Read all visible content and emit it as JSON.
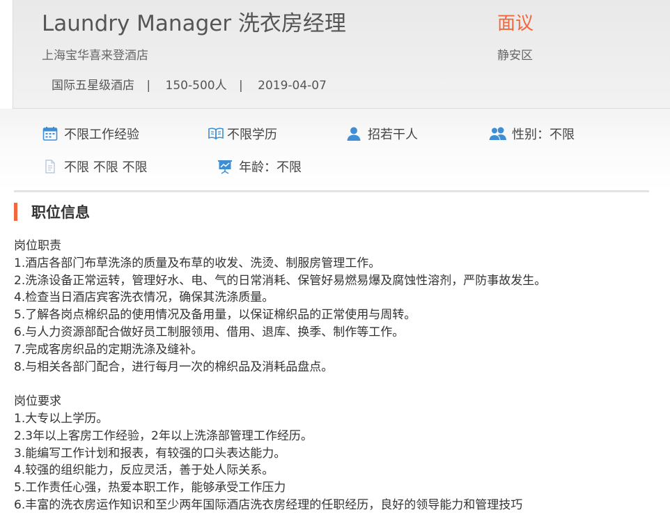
{
  "job": {
    "title": "Laundry Manager 洗衣房经理",
    "salary": "面议",
    "company": "上海宝华喜来登酒店",
    "district": "静安区",
    "meta": {
      "industry": "国际五星级酒店",
      "size": "150-500人",
      "date": "2019-04-07",
      "separator": "|"
    }
  },
  "requirements": {
    "experience": {
      "icon": "calendar-icon",
      "label": "不限工作经验"
    },
    "education": {
      "icon": "book-icon",
      "label": "不限学历"
    },
    "headcount": {
      "icon": "person-icon",
      "label": "招若干人"
    },
    "gender": {
      "icon": "people-icon",
      "label": "性别：不限"
    },
    "other": {
      "icon": "document-icon",
      "label": "不限 不限 不限"
    },
    "age": {
      "icon": "presentation-icon",
      "label": "年龄：不限"
    }
  },
  "section": {
    "title": "职位信息"
  },
  "description": {
    "duties_heading": "岗位职责",
    "duties": [
      "1.酒店各部门布草洗涤的质量及布草的收发、洗烫、制服房管理工作。",
      "2.洗涤设备正常运转，管理好水、电、气的日常消耗、保管好易燃易爆及腐蚀性溶剂，严防事故发生。",
      "4.检查当日酒店宾客洗衣情况，确保其洗涤质量。",
      "5.了解各岗点棉织品的使用情况及备用量，以保证棉织品的正常使用与周转。",
      "6.与人力资源部配合做好员工制服领用、借用、退库、换季、制作等工作。",
      "7.完成客房织品的定期洗涤及缝补。",
      "8.与相关各部门配合，进行每月一次的棉织品及消耗品盘点。"
    ],
    "requirements_heading": "岗位要求",
    "requirements": [
      "1.大专以上学历。",
      "2.3年以上客房工作经验，2年以上洗涤部管理工作经历。",
      "3.能编写工作计划和报表，有较强的口头表达能力。",
      "4.较强的组织能力，反应灵活，善于处人际关系。",
      "5.工作责任心强，热爱本职工作，能够承受工作压力",
      "6.丰富的洗衣房运作知识和至少两年国际酒店洗衣房经理的任职经历，良好的领导能力和管理技巧"
    ]
  },
  "colors": {
    "accent": "#f2683c",
    "icon_blue": "#3e8ed6"
  }
}
